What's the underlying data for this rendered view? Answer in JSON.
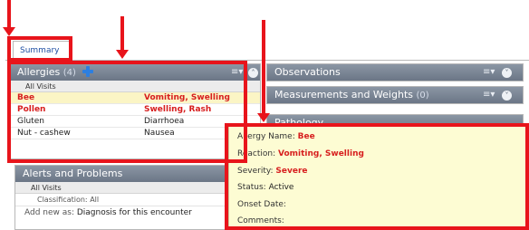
{
  "tabs": [
    {
      "label": "Summary"
    }
  ],
  "allergies": {
    "title": "Allergies",
    "count": "(4)",
    "filter": "All Visits",
    "rows": [
      {
        "name": "Bee",
        "reaction": "Vomiting, Swelling"
      },
      {
        "name": "Pollen",
        "reaction": "Swelling, Rash"
      },
      {
        "name": "Gluten",
        "reaction": "Diarrhoea"
      },
      {
        "name": "Nut - cashew",
        "reaction": "Nausea"
      }
    ]
  },
  "alerts": {
    "title": "Alerts and Problems",
    "filter": "All Visits",
    "classification_label": "Classification:",
    "classification_value": "All",
    "add_new_label": "Add new as:",
    "add_new_value": "Diagnosis for this encounter"
  },
  "observations": {
    "title": "Observations"
  },
  "measurements": {
    "title": "Measurements and Weights",
    "count": "(0)"
  },
  "pathology": {
    "title": "Pathology"
  },
  "popup": {
    "allergy_name_label": "Allergy Name:",
    "allergy_name": "Bee",
    "reaction_label": "Reaction:",
    "reaction": "Vomiting, Swelling",
    "severity_label": "Severity:",
    "severity": "Severe",
    "status_label": "Status:",
    "status": "Active",
    "onset_label": "Onset Date:",
    "onset": "",
    "comments_label": "Comments:",
    "comments": ""
  },
  "icons": {
    "menu": "menu-dropdown-icon",
    "collapse": "collapse-icon",
    "add": "plus-icon"
  },
  "colors": {
    "annotation": "#e8141b",
    "severe_text": "#d71e1e",
    "header": "#7a8596",
    "highlight": "#fbf5c5",
    "popup": "#fdfcd3"
  }
}
